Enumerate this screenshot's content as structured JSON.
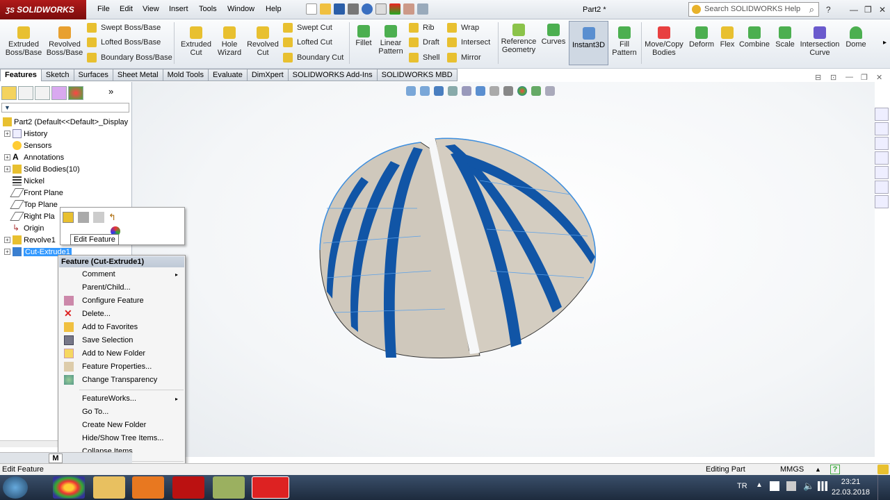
{
  "app": {
    "logo_text": "SOLIDWORKS",
    "doc_title": "Part2 *",
    "search_placeholder": "Search SOLIDWORKS Help"
  },
  "menu": [
    "File",
    "Edit",
    "View",
    "Insert",
    "Tools",
    "Window",
    "Help"
  ],
  "toolbar": {
    "extruded_boss": "Extruded\nBoss/Base",
    "revolved_boss": "Revolved\nBoss/Base",
    "swept_boss": "Swept Boss/Base",
    "lofted_boss": "Lofted Boss/Base",
    "boundary_boss": "Boundary Boss/Base",
    "extruded_cut": "Extruded\nCut",
    "hole_wizard": "Hole\nWizard",
    "revolved_cut": "Revolved\nCut",
    "swept_cut": "Swept Cut",
    "lofted_cut": "Lofted Cut",
    "boundary_cut": "Boundary Cut",
    "fillet": "Fillet",
    "linear_pattern": "Linear\nPattern",
    "rib": "Rib",
    "draft": "Draft",
    "shell": "Shell",
    "wrap": "Wrap",
    "intersect": "Intersect",
    "mirror": "Mirror",
    "reference_geometry": "Reference\nGeometry",
    "curves": "Curves",
    "instant3d": "Instant3D",
    "fill_pattern": "Fill\nPattern",
    "move_copy": "Move/Copy\nBodies",
    "deform": "Deform",
    "flex": "Flex",
    "combine": "Combine",
    "scale": "Scale",
    "intersection_curve": "Intersection\nCurve",
    "dome": "Dome"
  },
  "tabs": [
    "Features",
    "Sketch",
    "Surfaces",
    "Sheet Metal",
    "Mold Tools",
    "Evaluate",
    "DimXpert",
    "SOLIDWORKS Add-Ins",
    "SOLIDWORKS MBD"
  ],
  "tree": {
    "root": "Part2  (Default<<Default>_Display",
    "items": [
      "History",
      "Sensors",
      "Annotations",
      "Solid Bodies(10)",
      "Nickel",
      "Front Plane",
      "Top Plane",
      "Right Pla",
      "Origin",
      "Revolve1",
      "Cut-Extrude1"
    ]
  },
  "tooltip": "Edit Feature",
  "context_menu": {
    "header": "Feature (Cut-Extrude1)",
    "items": [
      "Comment",
      "Parent/Child...",
      "Configure Feature",
      "Delete...",
      "Add to Favorites",
      "Save Selection",
      "Add to New Folder",
      "Feature Properties...",
      "Change Transparency",
      "FeatureWorks...",
      "Go To...",
      "Create New Folder",
      "Hide/Show Tree Items...",
      "Collapse Items"
    ],
    "more": "⌄"
  },
  "status": {
    "left": "Edit Feature",
    "editing": "Editing Part",
    "units": "MMGS",
    "tab_m": "M"
  },
  "tray": {
    "lang": "TR",
    "time": "23:21",
    "date": "22.03.2018"
  },
  "colors": {
    "accent_red": "#b01a1a",
    "selection_blue": "#3399ff",
    "stripe_blue": "#1155a6",
    "body": "#cfc8bc"
  }
}
